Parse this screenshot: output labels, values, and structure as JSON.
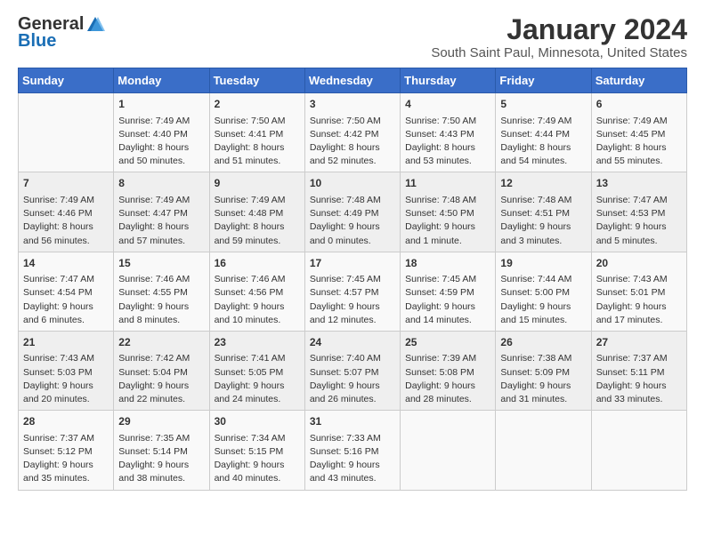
{
  "logo": {
    "general": "General",
    "blue": "Blue"
  },
  "calendar": {
    "title": "January 2024",
    "subtitle": "South Saint Paul, Minnesota, United States"
  },
  "weekdays": [
    "Sunday",
    "Monday",
    "Tuesday",
    "Wednesday",
    "Thursday",
    "Friday",
    "Saturday"
  ],
  "weeks": [
    [
      {
        "day": "",
        "info": ""
      },
      {
        "day": "1",
        "info": "Sunrise: 7:49 AM\nSunset: 4:40 PM\nDaylight: 8 hours\nand 50 minutes."
      },
      {
        "day": "2",
        "info": "Sunrise: 7:50 AM\nSunset: 4:41 PM\nDaylight: 8 hours\nand 51 minutes."
      },
      {
        "day": "3",
        "info": "Sunrise: 7:50 AM\nSunset: 4:42 PM\nDaylight: 8 hours\nand 52 minutes."
      },
      {
        "day": "4",
        "info": "Sunrise: 7:50 AM\nSunset: 4:43 PM\nDaylight: 8 hours\nand 53 minutes."
      },
      {
        "day": "5",
        "info": "Sunrise: 7:49 AM\nSunset: 4:44 PM\nDaylight: 8 hours\nand 54 minutes."
      },
      {
        "day": "6",
        "info": "Sunrise: 7:49 AM\nSunset: 4:45 PM\nDaylight: 8 hours\nand 55 minutes."
      }
    ],
    [
      {
        "day": "7",
        "info": "Sunrise: 7:49 AM\nSunset: 4:46 PM\nDaylight: 8 hours\nand 56 minutes."
      },
      {
        "day": "8",
        "info": "Sunrise: 7:49 AM\nSunset: 4:47 PM\nDaylight: 8 hours\nand 57 minutes."
      },
      {
        "day": "9",
        "info": "Sunrise: 7:49 AM\nSunset: 4:48 PM\nDaylight: 8 hours\nand 59 minutes."
      },
      {
        "day": "10",
        "info": "Sunrise: 7:48 AM\nSunset: 4:49 PM\nDaylight: 9 hours\nand 0 minutes."
      },
      {
        "day": "11",
        "info": "Sunrise: 7:48 AM\nSunset: 4:50 PM\nDaylight: 9 hours\nand 1 minute."
      },
      {
        "day": "12",
        "info": "Sunrise: 7:48 AM\nSunset: 4:51 PM\nDaylight: 9 hours\nand 3 minutes."
      },
      {
        "day": "13",
        "info": "Sunrise: 7:47 AM\nSunset: 4:53 PM\nDaylight: 9 hours\nand 5 minutes."
      }
    ],
    [
      {
        "day": "14",
        "info": "Sunrise: 7:47 AM\nSunset: 4:54 PM\nDaylight: 9 hours\nand 6 minutes."
      },
      {
        "day": "15",
        "info": "Sunrise: 7:46 AM\nSunset: 4:55 PM\nDaylight: 9 hours\nand 8 minutes."
      },
      {
        "day": "16",
        "info": "Sunrise: 7:46 AM\nSunset: 4:56 PM\nDaylight: 9 hours\nand 10 minutes."
      },
      {
        "day": "17",
        "info": "Sunrise: 7:45 AM\nSunset: 4:57 PM\nDaylight: 9 hours\nand 12 minutes."
      },
      {
        "day": "18",
        "info": "Sunrise: 7:45 AM\nSunset: 4:59 PM\nDaylight: 9 hours\nand 14 minutes."
      },
      {
        "day": "19",
        "info": "Sunrise: 7:44 AM\nSunset: 5:00 PM\nDaylight: 9 hours\nand 15 minutes."
      },
      {
        "day": "20",
        "info": "Sunrise: 7:43 AM\nSunset: 5:01 PM\nDaylight: 9 hours\nand 17 minutes."
      }
    ],
    [
      {
        "day": "21",
        "info": "Sunrise: 7:43 AM\nSunset: 5:03 PM\nDaylight: 9 hours\nand 20 minutes."
      },
      {
        "day": "22",
        "info": "Sunrise: 7:42 AM\nSunset: 5:04 PM\nDaylight: 9 hours\nand 22 minutes."
      },
      {
        "day": "23",
        "info": "Sunrise: 7:41 AM\nSunset: 5:05 PM\nDaylight: 9 hours\nand 24 minutes."
      },
      {
        "day": "24",
        "info": "Sunrise: 7:40 AM\nSunset: 5:07 PM\nDaylight: 9 hours\nand 26 minutes."
      },
      {
        "day": "25",
        "info": "Sunrise: 7:39 AM\nSunset: 5:08 PM\nDaylight: 9 hours\nand 28 minutes."
      },
      {
        "day": "26",
        "info": "Sunrise: 7:38 AM\nSunset: 5:09 PM\nDaylight: 9 hours\nand 31 minutes."
      },
      {
        "day": "27",
        "info": "Sunrise: 7:37 AM\nSunset: 5:11 PM\nDaylight: 9 hours\nand 33 minutes."
      }
    ],
    [
      {
        "day": "28",
        "info": "Sunrise: 7:37 AM\nSunset: 5:12 PM\nDaylight: 9 hours\nand 35 minutes."
      },
      {
        "day": "29",
        "info": "Sunrise: 7:35 AM\nSunset: 5:14 PM\nDaylight: 9 hours\nand 38 minutes."
      },
      {
        "day": "30",
        "info": "Sunrise: 7:34 AM\nSunset: 5:15 PM\nDaylight: 9 hours\nand 40 minutes."
      },
      {
        "day": "31",
        "info": "Sunrise: 7:33 AM\nSunset: 5:16 PM\nDaylight: 9 hours\nand 43 minutes."
      },
      {
        "day": "",
        "info": ""
      },
      {
        "day": "",
        "info": ""
      },
      {
        "day": "",
        "info": ""
      }
    ]
  ]
}
